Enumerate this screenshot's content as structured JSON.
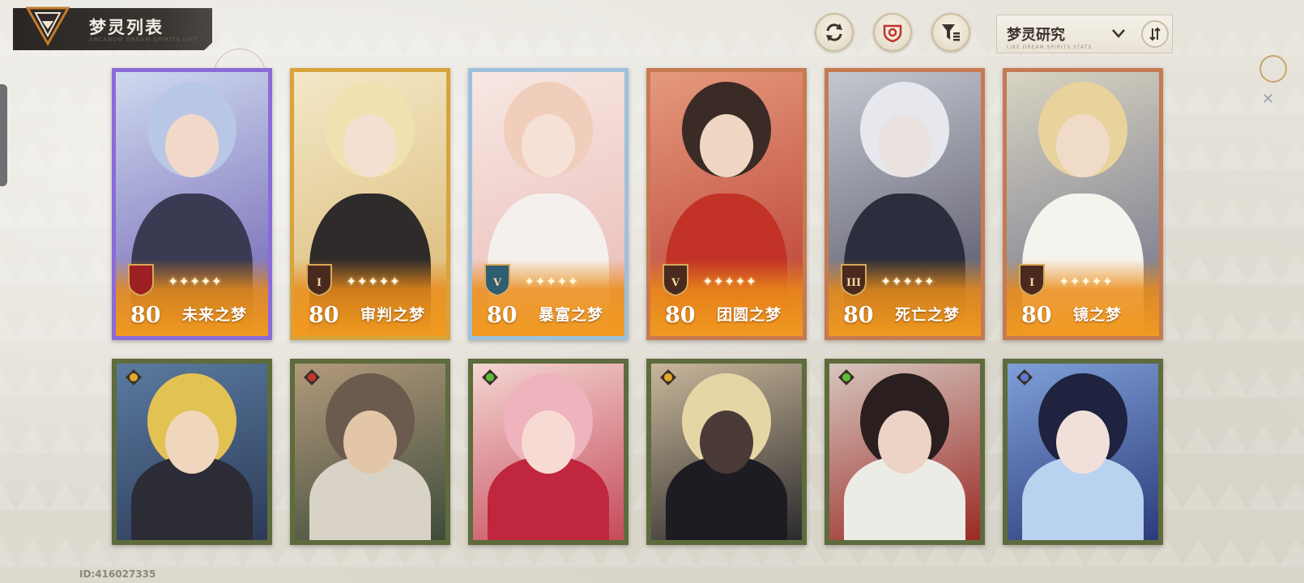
{
  "header": {
    "title": "梦灵列表",
    "title_subtitle": "ARCANUM DREAM SPIRITS LIST",
    "buttons": [
      {
        "name": "refresh-icon"
      },
      {
        "name": "target-icon"
      },
      {
        "name": "filter-icon"
      }
    ],
    "sort": {
      "label": "梦灵研究",
      "subtitle": "LIKE DREAM SPIRITS STATS",
      "chevron": "chevron-down-icon",
      "order_icon": "sort-order-icon"
    }
  },
  "row1": [
    {
      "level": "80",
      "name": "未来之梦",
      "rank": "",
      "stars": "✦✦✦✦✦",
      "frame": "#8a6bd8",
      "bg1": "#cfd9ef",
      "bg2": "#6b5fb0",
      "hair": "#b9c7e6",
      "skin": "#f1d8c8",
      "cloth": "#3a3a52"
    },
    {
      "level": "80",
      "name": "审判之梦",
      "rank": "I",
      "stars": "✦✦✦✦✦",
      "frame": "#d7a33a",
      "bg1": "#f4e7c8",
      "bg2": "#d8b872",
      "hair": "#efe2b0",
      "skin": "#f4e0d0",
      "cloth": "#2e2b2a"
    },
    {
      "level": "80",
      "name": "暴富之梦",
      "rank": "V",
      "stars": "✦✦✦✦✦",
      "frame": "#9fc0dc",
      "bg1": "#f7e8e3",
      "bg2": "#e9b9b5",
      "hair": "#f1cdbb",
      "skin": "#f6e1d6",
      "cloth": "#f4f0ee"
    },
    {
      "level": "80",
      "name": "团圆之梦",
      "rank": "V",
      "stars": "✦✦✦✦✦",
      "frame": "#c67a52",
      "bg1": "#e59a7c",
      "bg2": "#b83a32",
      "hair": "#3b2b26",
      "skin": "#f0d7c4",
      "cloth": "#c23226"
    },
    {
      "level": "80",
      "name": "死亡之梦",
      "rank": "III",
      "stars": "✦✦✦✦✦",
      "frame": "#c67a52",
      "bg1": "#c5c7d0",
      "bg2": "#4e4c60",
      "hair": "#e6e8ee",
      "skin": "#e9e2de",
      "cloth": "#2b2e3c"
    },
    {
      "level": "80",
      "name": "镜之梦",
      "rank": "I",
      "stars": "✦✦✦✦✦",
      "frame": "#c67a52",
      "bg1": "#d8d4c2",
      "bg2": "#6d6e86",
      "hair": "#e8d39c",
      "skin": "#f0dbc8",
      "cloth": "#f5f3ee"
    }
  ],
  "row2": [
    {
      "elem": "#e2a82a",
      "bg1": "#5a7ba0",
      "bg2": "#2c3a58",
      "hair": "#e3c254",
      "skin": "#f1d6be",
      "cloth": "#2b2c36"
    },
    {
      "elem": "#c8322e",
      "bg1": "#b39a7c",
      "bg2": "#3d4c3a",
      "hair": "#6b5a4e",
      "skin": "#e3c5a8",
      "cloth": "#d9d2c7"
    },
    {
      "elem": "#5fbb3a",
      "bg1": "#f3d6d2",
      "bg2": "#c64a5a",
      "hair": "#efb3bd",
      "skin": "#f7dad4",
      "cloth": "#c0263d"
    },
    {
      "elem": "#e2a82a",
      "bg1": "#c9b79a",
      "bg2": "#2b2a2c",
      "hair": "#e7d6a5",
      "skin": "#4a3b38",
      "cloth": "#1d1c22"
    },
    {
      "elem": "#5fbb3a",
      "bg1": "#d6c6bf",
      "bg2": "#9a2a24",
      "hair": "#2a1f1e",
      "skin": "#ecd3c5",
      "cloth": "#ecece6"
    },
    {
      "elem": "#5a7bd0",
      "bg1": "#7f9fd8",
      "bg2": "#2b3c7a",
      "hair": "#1f2340",
      "skin": "#f1e0da",
      "cloth": "#b9d2f0"
    }
  ],
  "footer": {
    "id_text": "ID:416027335"
  }
}
